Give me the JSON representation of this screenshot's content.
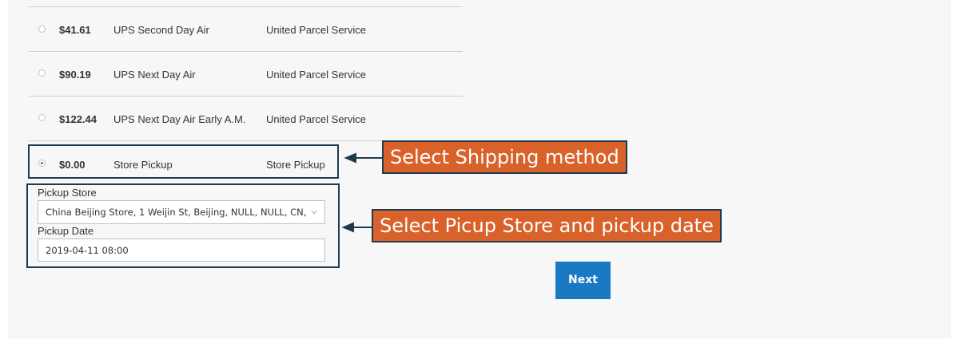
{
  "shipping_methods": [
    {
      "price": "$41.61",
      "method": "UPS Second Day Air",
      "carrier": "United Parcel Service",
      "selected": false
    },
    {
      "price": "$90.19",
      "method": "UPS Next Day Air",
      "carrier": "United Parcel Service",
      "selected": false
    },
    {
      "price": "$122.44",
      "method": "UPS Next Day Air Early A.M.",
      "carrier": "United Parcel Service",
      "selected": false
    },
    {
      "price": "$0.00",
      "method": "Store Pickup",
      "carrier": "Store Pickup",
      "selected": true
    }
  ],
  "pickup": {
    "store_label": "Pickup Store",
    "store_value": "China Beijing Store, 1 Weijin St, Beijing, NULL, NULL, CN,",
    "date_label": "Pickup Date",
    "date_value": "2019-04-11 08:00"
  },
  "annotations": {
    "shipping": "Select Shipping method",
    "store": "Select Picup Store and pickup date"
  },
  "buttons": {
    "next": "Next"
  },
  "colors": {
    "accent": "#1979c3",
    "callout": "#d9622b",
    "outline": "#1e3a4c"
  }
}
